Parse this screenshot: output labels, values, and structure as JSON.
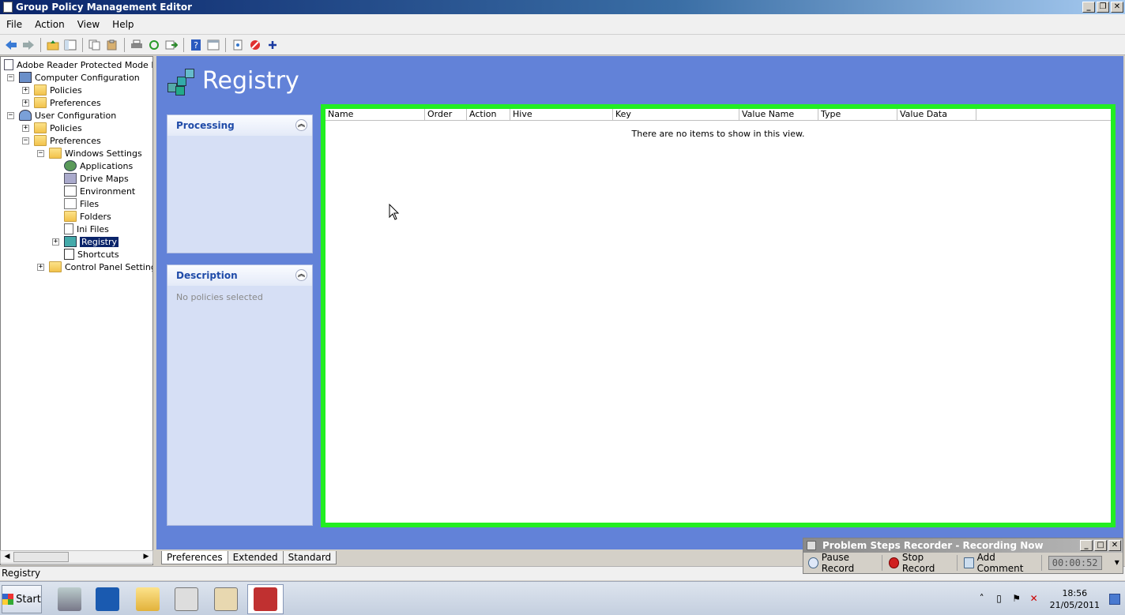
{
  "window": {
    "title": "Group Policy Management Editor",
    "btn_min": "_",
    "btn_max": "❐",
    "btn_close": "✕"
  },
  "menu": [
    "File",
    "Action",
    "View",
    "Help"
  ],
  "toolbar_icons": [
    "back-icon",
    "forward-icon",
    "up-folder-icon",
    "show-hide-tree-icon",
    "copy-icon",
    "paste-icon",
    "print-icon",
    "refresh-icon",
    "export-icon",
    "help-icon",
    "properties-icon",
    "snapshot-icon",
    "stop-icon",
    "add-icon"
  ],
  "tree": {
    "root": "Adobe Reader Protected Mode Disa",
    "computer_config": "Computer Configuration",
    "cc_policies": "Policies",
    "cc_preferences": "Preferences",
    "user_config": "User Configuration",
    "uc_policies": "Policies",
    "uc_preferences": "Preferences",
    "windows_settings": "Windows Settings",
    "applications": "Applications",
    "drive_maps": "Drive Maps",
    "environment": "Environment",
    "files": "Files",
    "folders": "Folders",
    "ini_files": "Ini Files",
    "registry": "Registry",
    "shortcuts": "Shortcuts",
    "control_panel": "Control Panel Settings"
  },
  "main": {
    "title": "Registry",
    "processing_title": "Processing",
    "description_title": "Description",
    "description_text": "No policies selected",
    "columns": [
      "Name",
      "Order",
      "Action",
      "Hive",
      "Key",
      "Value Name",
      "Type",
      "Value Data"
    ],
    "empty_message": "There are no items to show in this view."
  },
  "tabs": [
    "Preferences",
    "Extended",
    "Standard"
  ],
  "status": "Registry",
  "psr": {
    "title": "Problem Steps Recorder - Recording Now",
    "pause": "Pause Record",
    "stop": "Stop Record",
    "comment": "Add Comment",
    "timer": "00:00:52"
  },
  "taskbar": {
    "start": "Start",
    "time": "18:56",
    "date": "21/05/2011"
  }
}
